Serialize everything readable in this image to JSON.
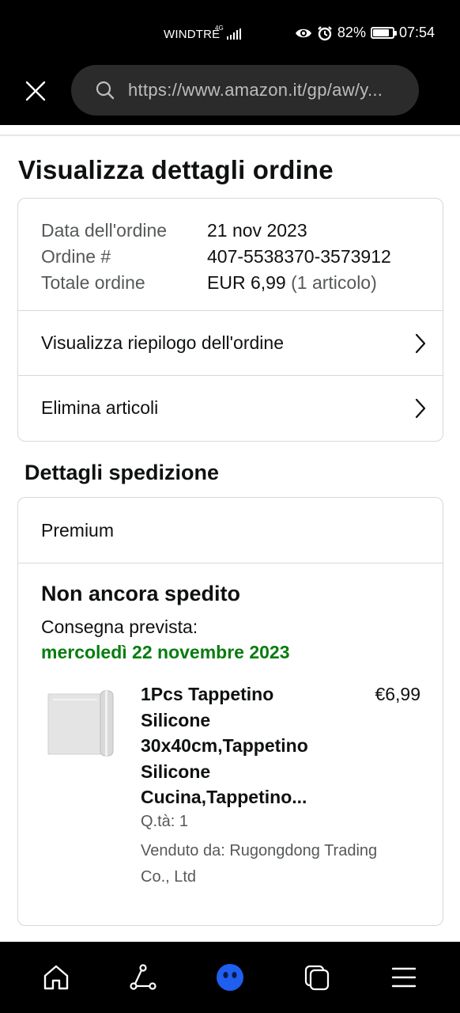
{
  "status_bar": {
    "carrier": "WINDTRE",
    "network_badge": "4G",
    "battery_percent": "82%",
    "battery_level": 0.82,
    "time": "07:54",
    "icons": [
      "signal-icon",
      "eye-icon",
      "alarm-icon",
      "battery-icon"
    ]
  },
  "browser": {
    "url": "https://www.amazon.it/gp/aw/y...",
    "close_icon": "close-icon",
    "search_icon": "search-icon"
  },
  "page": {
    "title": "Visualizza dettagli ordine",
    "order_info": {
      "date_label": "Data dell'ordine",
      "date_value": "21 nov 2023",
      "number_label": "Ordine #",
      "number_value": "407-5538370-3573912",
      "total_label": "Totale ordine",
      "total_value": "EUR 6,99",
      "total_items": "(1 articolo)"
    },
    "actions": {
      "summary": "Visualizza riepilogo dell'ordine",
      "delete": "Elimina articoli"
    },
    "shipping": {
      "section_title": "Dettagli spedizione",
      "type": "Premium",
      "status": "Non ancora spedito",
      "delivery_label": "Consegna prevista:",
      "delivery_date": "mercoledì 22 novembre 2023",
      "delivery_color": "#067d0e",
      "product": {
        "title": "1Pcs Tappetino Silicone 30x40cm,Tappetino Silicone Cucina,Tappetino...",
        "price": "€6,99",
        "quantity": "Q.tà: 1",
        "seller": "Venduto da: Rugongdong Trading Co., Ltd"
      }
    }
  },
  "bottom_nav": [
    "home-icon",
    "route-icon",
    "assistant-icon",
    "tabs-icon",
    "menu-icon"
  ],
  "colors": {
    "accent_blue": "#1f5ff0",
    "text": "#0f1111",
    "muted": "#565959"
  }
}
